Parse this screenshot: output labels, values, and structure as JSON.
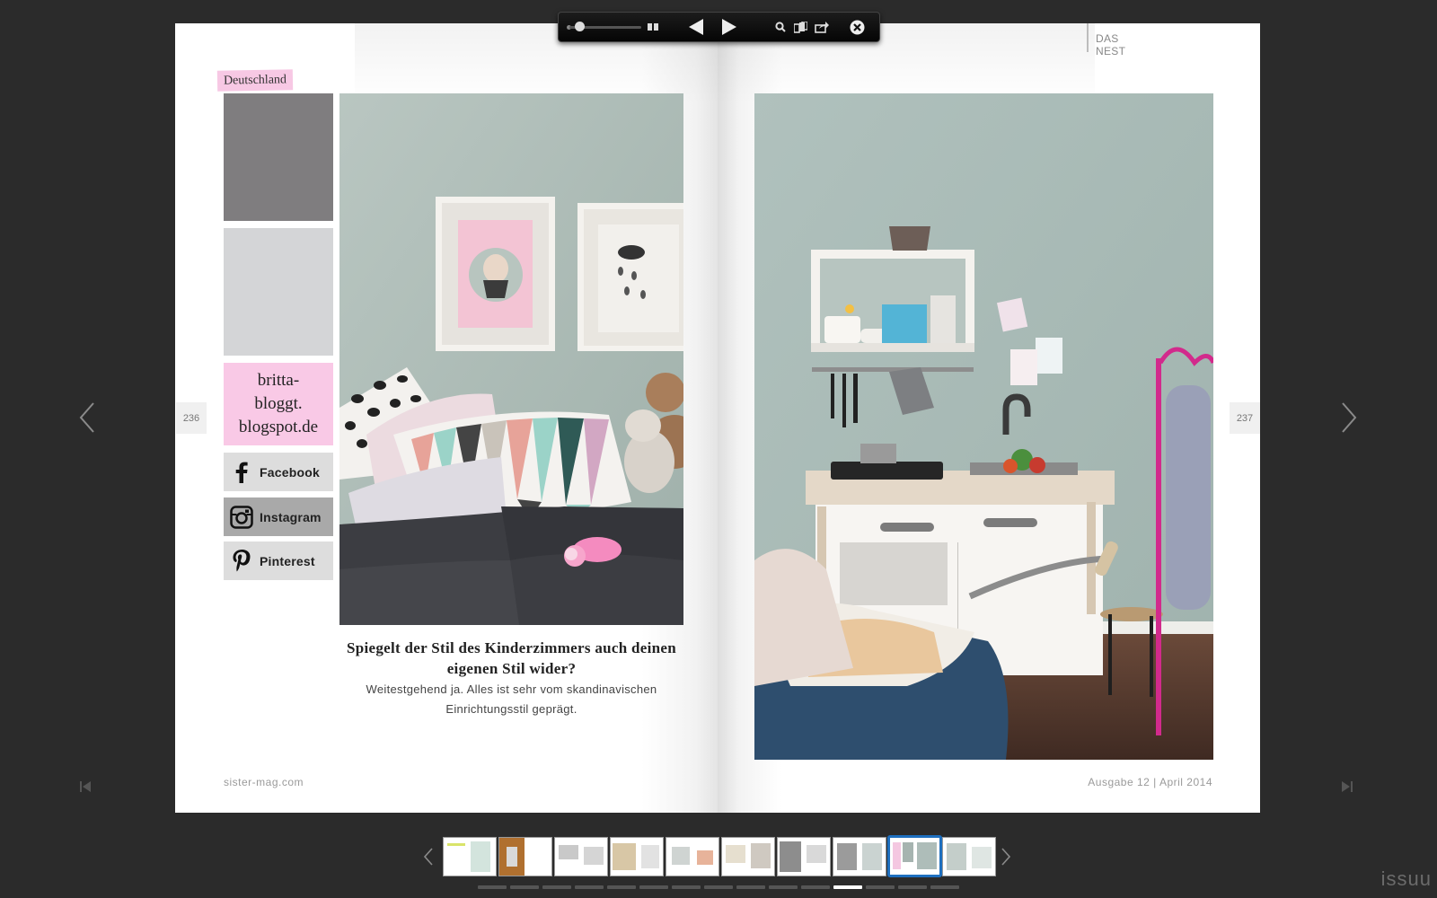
{
  "toolbar": {
    "zoom_level": 0.15,
    "icons": [
      "zoom-slider",
      "spread-view-icon",
      "previous-page-icon",
      "next-page-icon",
      "search-icon",
      "library-icon",
      "share-icon",
      "close-icon"
    ]
  },
  "left_page": {
    "page_number": "236",
    "country_tag": "Deutschland",
    "swatch_colors": [
      "#7f7d7f",
      "#d4d5d7",
      "#f9c9e6"
    ],
    "blog_lines": [
      "britta-",
      "bloggt.",
      "blogspot.de"
    ],
    "social": [
      {
        "label": "Facebook",
        "icon": "facebook-icon"
      },
      {
        "label": "Instagram",
        "icon": "instagram-icon"
      },
      {
        "label": "Pinterest",
        "icon": "pinterest-icon"
      }
    ],
    "question": "Spiegelt der Stil des Kinderzimmers auch deinen eigenen Stil wider?",
    "answer": "Weitestgehend ja. Alles ist sehr vom skandinavischen Einrichtungsstil geprägt.",
    "footer": "sister-mag.com"
  },
  "right_page": {
    "page_number": "237",
    "section": "DAS NEST",
    "footer": "Ausgabe 12 | April 2014"
  },
  "thumbnails": {
    "count": 10,
    "selected_index": 8
  },
  "progress": {
    "segments": 15,
    "active_index": 11
  },
  "brand": "issuu",
  "colors": {
    "background": "#2b2b2b",
    "selected_thumb": "#1e6fbf",
    "pink_accent": "#f9c9e6"
  }
}
